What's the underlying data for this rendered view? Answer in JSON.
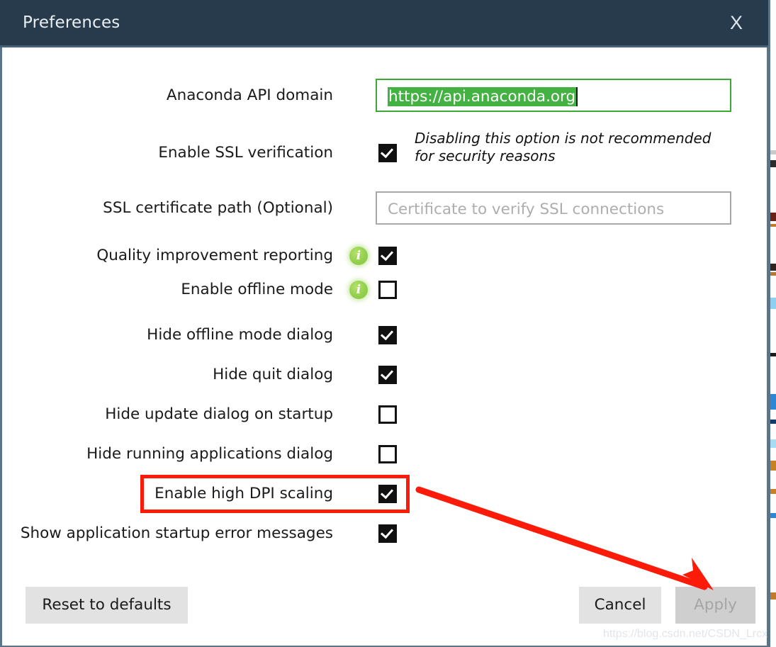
{
  "window": {
    "title": "Preferences",
    "close_label": "X",
    "titlebar_color": "#283b4c",
    "border_color": "#5b7488"
  },
  "fields": {
    "api_domain": {
      "label": "Anaconda API domain",
      "value": "https://api.anaconda.org",
      "selected": true,
      "focus_border_color": "#3aaa35",
      "selection_color": "#44b143"
    },
    "ssl_verification": {
      "label": "Enable SSL verification",
      "checked": true,
      "hint": "Disabling this option is not recommended for security reasons"
    },
    "ssl_cert_path": {
      "label": "SSL certificate path (Optional)",
      "value": "",
      "placeholder": "Certificate to verify SSL connections"
    }
  },
  "checkboxes": [
    {
      "label": "Quality improvement reporting",
      "checked": true,
      "info": true,
      "info_glyph": "i"
    },
    {
      "label": "Enable offline mode",
      "checked": false,
      "info": true,
      "info_glyph": "i"
    },
    {
      "label": "Hide offline mode dialog",
      "checked": true,
      "info": false
    },
    {
      "label": "Hide quit dialog",
      "checked": true,
      "info": false
    },
    {
      "label": "Hide update dialog on startup",
      "checked": false,
      "info": false
    },
    {
      "label": "Hide running applications dialog",
      "checked": false,
      "info": false
    },
    {
      "label": "Enable high DPI scaling",
      "checked": true,
      "info": false,
      "highlighted": true
    },
    {
      "label": "Show application startup error messages",
      "checked": true,
      "info": false
    }
  ],
  "footer": {
    "reset_label": "Reset to defaults",
    "cancel_label": "Cancel",
    "apply_label": "Apply",
    "apply_disabled": true
  },
  "annotations": {
    "highlight_color": "#fb1b08",
    "arrow_color": "#fb1b08"
  },
  "watermark": "https://blog.csdn.net/CSDN_Lrcx"
}
